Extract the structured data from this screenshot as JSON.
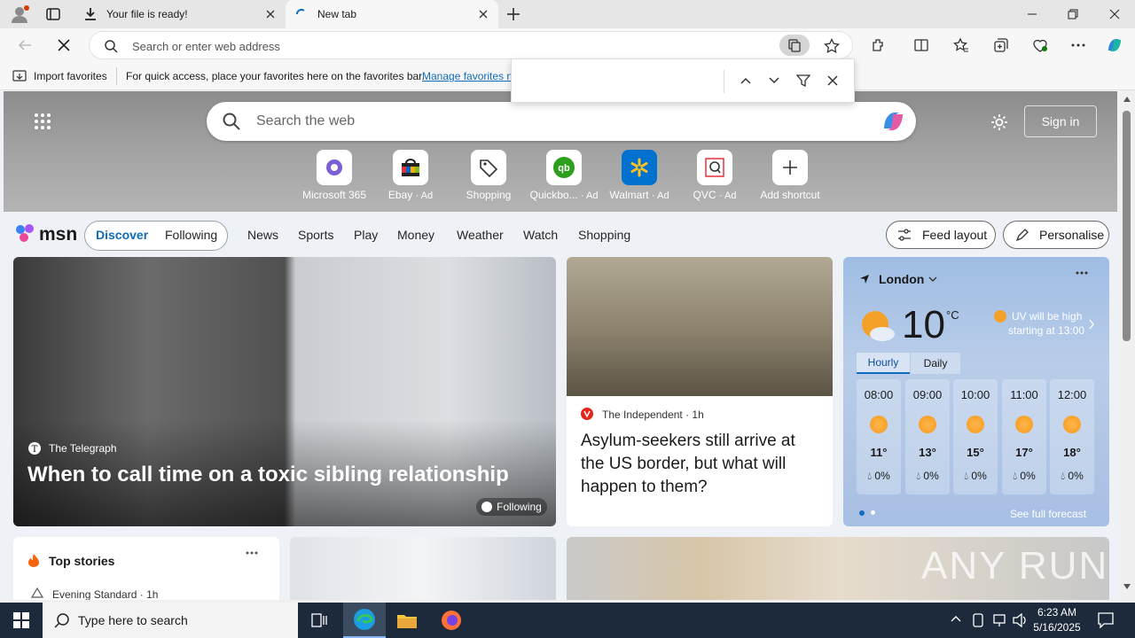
{
  "tabs": [
    {
      "title": "Your file is ready!",
      "active": false
    },
    {
      "title": "New tab",
      "active": true
    }
  ],
  "address": {
    "placeholder": "Search or enter web address"
  },
  "favorites": {
    "import_label": "Import favorites",
    "hint": "For quick access, place your favorites here on the favorites bar.",
    "manage_link": "Manage favorites n"
  },
  "hero": {
    "search_placeholder": "Search the web",
    "signin": "Sign in",
    "shortcuts": [
      {
        "label": "Microsoft 365",
        "ad": ""
      },
      {
        "label": "Ebay",
        "ad": "· Ad"
      },
      {
        "label": "Shopping",
        "ad": ""
      },
      {
        "label": "Quickbo...",
        "ad": "· Ad"
      },
      {
        "label": "Walmart",
        "ad": "· Ad"
      },
      {
        "label": "QVC",
        "ad": "· Ad"
      },
      {
        "label": "Add shortcut",
        "ad": ""
      }
    ]
  },
  "msn": {
    "logo": "msn",
    "tabs": [
      "Discover",
      "Following"
    ],
    "links": [
      "News",
      "Sports",
      "Play",
      "Money",
      "Weather",
      "Watch",
      "Shopping"
    ],
    "feed_layout": "Feed layout",
    "personalise": "Personalise"
  },
  "main_story": {
    "source": "The Telegraph",
    "headline": "When to call time on a toxic sibling relationship",
    "following": "Following"
  },
  "news_card": {
    "source": "The Independent",
    "age": "1h",
    "headline": "Asylum-seekers still arrive at the US border, but what will happen to them?"
  },
  "weather": {
    "location": "London",
    "temp": "10",
    "unit": "°C",
    "uv_line1": "UV will be high",
    "uv_line2": "starting at 13:00",
    "tab_hourly": "Hourly",
    "tab_daily": "Daily",
    "hours": [
      {
        "time": "08:00",
        "temp": "11°",
        "precip": "0%"
      },
      {
        "time": "09:00",
        "temp": "13°",
        "precip": "0%"
      },
      {
        "time": "10:00",
        "temp": "15°",
        "precip": "0%"
      },
      {
        "time": "11:00",
        "temp": "17°",
        "precip": "0%"
      },
      {
        "time": "12:00",
        "temp": "18°",
        "precip": "0%"
      }
    ],
    "full_forecast": "See full forecast"
  },
  "top_stories": {
    "title": "Top stories",
    "source": "Evening Standard",
    "age": "1h"
  },
  "taskbar": {
    "search_placeholder": "Type here to search",
    "time": "6:23 AM",
    "date": "5/16/2025"
  },
  "watermark": "ANY RUN"
}
